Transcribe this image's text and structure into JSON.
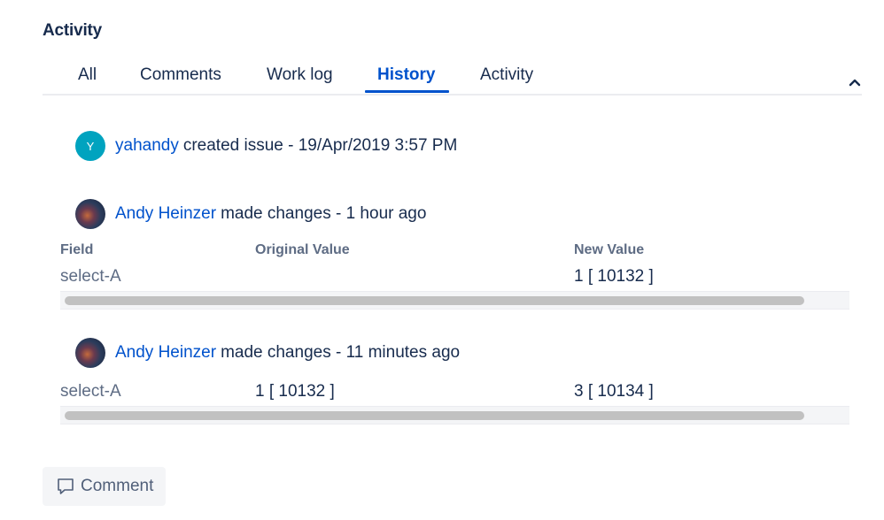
{
  "section": {
    "title": "Activity"
  },
  "tabs": [
    {
      "label": "All",
      "active": false
    },
    {
      "label": "Comments",
      "active": false
    },
    {
      "label": "Work log",
      "active": false
    },
    {
      "label": "History",
      "active": true
    },
    {
      "label": "Activity",
      "active": false
    }
  ],
  "colors": {
    "link": "#0052cc",
    "text": "#172b4d",
    "muted": "#5e6c84",
    "avatar_bg": "#00a3bf"
  },
  "icons": {
    "collapse": "chevron-up-icon",
    "comment": "comment-icon"
  },
  "entries": [
    {
      "avatar_letter": "Y",
      "user": "yahandy",
      "action": "created issue - 19/Apr/2019 3:57 PM"
    },
    {
      "user": "Andy Heinzer",
      "action": "made changes - 1 hour ago"
    },
    {
      "user": "Andy Heinzer",
      "action": "made changes - 11 minutes ago"
    }
  ],
  "table": {
    "headers": {
      "field": "Field",
      "original": "Original Value",
      "new": "New Value"
    },
    "rows": [
      {
        "field": "select-A",
        "original": "",
        "new": "1 [ 10132 ]"
      },
      {
        "field": "select-A",
        "original": "1 [ 10132 ]",
        "new": "3 [ 10134 ]"
      }
    ]
  },
  "comment_button": {
    "label": "Comment"
  }
}
